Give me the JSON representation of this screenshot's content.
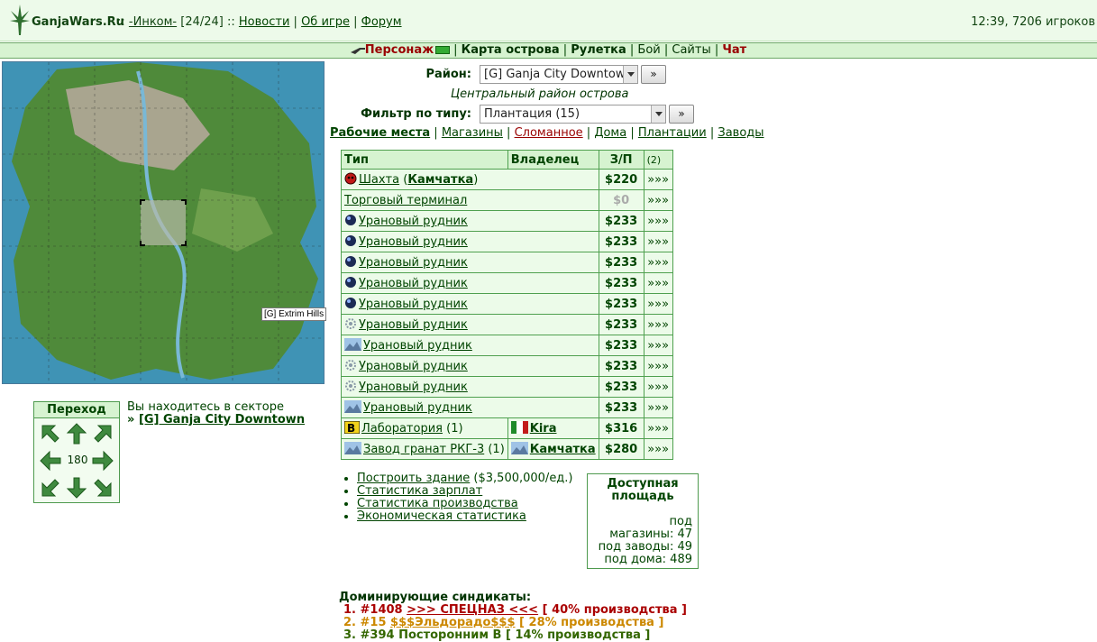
{
  "header": {
    "site_name": "GanjaWars.Ru",
    "sep1": " :: ",
    "user": "-Инком-",
    "level": "[24/24]",
    "sep2": " :: ",
    "news": "Новости",
    "about": "Об игре",
    "forum": "Форум",
    "clock": "12:39, 7206 игроков"
  },
  "nav": {
    "personage": "Персонаж",
    "map": "Карта острова",
    "roulette": "Рулетка",
    "fight": "Бой",
    "sites": "Сайты",
    "chat": "Чат"
  },
  "map": {
    "tooltip": "[G] Extrim Hills"
  },
  "perehod": {
    "title": "Переход",
    "value": "180"
  },
  "sector": {
    "text": "Вы находитесь в секторе",
    "prefix": "» ",
    "name": "[G] Ganja City Downtown"
  },
  "district": {
    "label": "Район:",
    "value": "[G] Ganja City Downtown",
    "go": "»",
    "description": "Центральный район острова"
  },
  "filter": {
    "label": "Фильтр по типу:",
    "value": "Плантация (15)",
    "go": "»"
  },
  "types": {
    "work": "Рабочие места",
    "shops": "Магазины",
    "broken": "Сломанное",
    "houses": "Дома",
    "plantations": "Плантации",
    "factories": "Заводы"
  },
  "table": {
    "headers": {
      "type": "Тип",
      "owner": "Владелец",
      "salary": "З/П",
      "extra": "(2)"
    },
    "rows": [
      {
        "name": "Шахта",
        "note_open": " (",
        "owner_inline": "Камчатка",
        "note_close": ")",
        "salary": "$220",
        "more": "»»»",
        "icon": "skull-icon"
      },
      {
        "name": "Торговый терминал",
        "salary": "$0",
        "more": "»»»",
        "icon": ""
      },
      {
        "name": "Урановый рудник",
        "salary": "$233",
        "more": "»»»",
        "icon": "sphere-icon"
      },
      {
        "name": "Урановый рудник",
        "salary": "$233",
        "more": "»»»",
        "icon": "sphere-icon"
      },
      {
        "name": "Урановый рудник",
        "salary": "$233",
        "more": "»»»",
        "icon": "sphere-icon"
      },
      {
        "name": "Урановый рудник",
        "salary": "$233",
        "more": "»»»",
        "icon": "sphere-icon"
      },
      {
        "name": "Урановый рудник",
        "salary": "$233",
        "more": "»»»",
        "icon": "sphere-icon"
      },
      {
        "name": "Урановый рудник",
        "salary": "$233",
        "more": "»»»",
        "icon": "gear-icon"
      },
      {
        "name": "Урановый рудник",
        "salary": "$233",
        "more": "»»»",
        "icon": "mountain-icon"
      },
      {
        "name": "Урановый рудник",
        "salary": "$233",
        "more": "»»»",
        "icon": "gear-icon"
      },
      {
        "name": "Урановый рудник",
        "salary": "$233",
        "more": "»»»",
        "icon": "gear-icon"
      },
      {
        "name": "Урановый рудник",
        "salary": "$233",
        "more": "»»»",
        "icon": "mountain-icon"
      },
      {
        "name": "Лаборатория",
        "count": " (1)",
        "owner": "Kira",
        "salary": "$316",
        "more": "»»»",
        "icon": "biohazard-icon",
        "owner_icon": "flag-icon"
      },
      {
        "name": "Завод гранат РКГ-3",
        "count": " (1)",
        "owner": "Камчатка",
        "salary": "$280",
        "more": "»»»",
        "icon": "mountain-icon",
        "owner_icon": "mountain-icon"
      }
    ]
  },
  "actions": {
    "build": "Построить здание",
    "build_price": " ($3,500,000/ед.)",
    "wages": "Статистика зарплат",
    "production": "Статистика производства",
    "economy": "Экономическая статистика"
  },
  "area": {
    "title": "Доступная площадь",
    "line1": "под",
    "line2": "магазины: 47",
    "line3": "под заводы: 49",
    "line4": "под дома: 489"
  },
  "syndicates": {
    "title": "Доминирующие синдикаты:",
    "items": [
      {
        "num": "1. #1408 ",
        "name": ">>> СПЕЦНАЗ <<<",
        "pct": " [ 40% производства ]"
      },
      {
        "num": "2. #15 ",
        "name": "$$$Эльдорадо$$$",
        "pct": " [ 28% производства ]"
      },
      {
        "num": "3. #394 ",
        "name": "Посторонним В",
        "pct": " [ 14% производства ]"
      }
    ]
  },
  "colors": {
    "accent": "#004400",
    "header_bg": "#edfaea",
    "nav_bg": "#d7f3d1",
    "cell_bg": "#ecfbe9",
    "border": "#4fa04f",
    "red": "#990000"
  }
}
